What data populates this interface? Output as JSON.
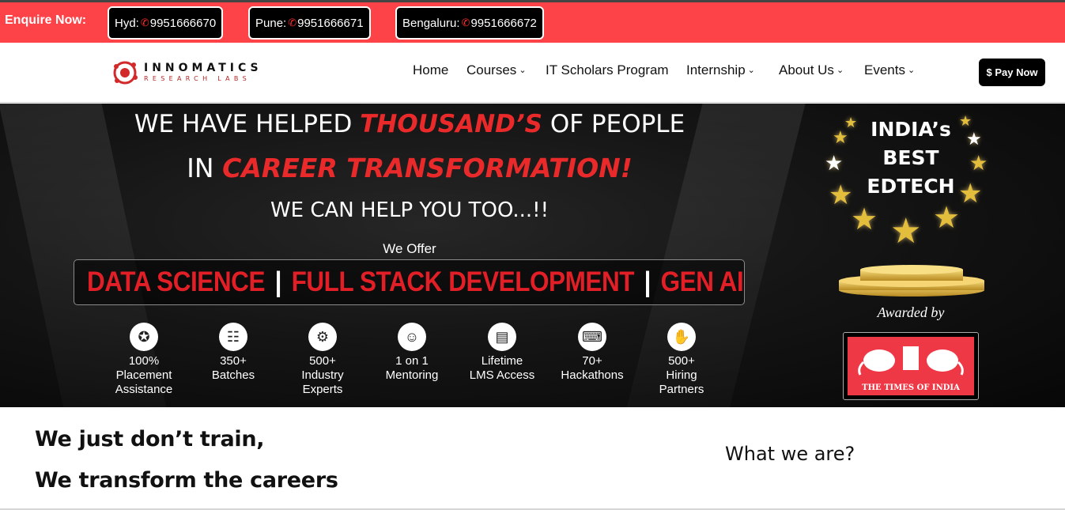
{
  "topbar": {
    "enquire_label": "Enquire Now:",
    "phones": [
      {
        "city": "Hyd:",
        "number": "9951666670"
      },
      {
        "city": "Pune:",
        "number": "9951666671"
      },
      {
        "city": "Bengaluru:",
        "number": "9951666672"
      }
    ],
    "phone_icon": "phone-icon"
  },
  "brand": {
    "name": "INNOMATICS",
    "sub": "RESEARCH LABS"
  },
  "nav": {
    "items": [
      {
        "label": "Home",
        "dropdown": false
      },
      {
        "label": "Courses",
        "dropdown": true
      },
      {
        "label": "IT Scholars Program",
        "dropdown": false
      },
      {
        "label": "Internship",
        "dropdown": true
      },
      {
        "label": "About Us",
        "dropdown": true
      },
      {
        "label": "Events",
        "dropdown": true
      }
    ],
    "pay_label": "$ Pay Now"
  },
  "hero": {
    "line1_a": "WE HAVE HELPED ",
    "line1_b": "THOUSAND’S",
    "line1_c": " OF PEOPLE",
    "line2_a": "IN ",
    "line2_b": "CAREER TRANSFORMATION!",
    "line3": "WE CAN HELP YOU TOO...!!",
    "we_offer": "We Offer",
    "offers": [
      "DATA SCIENCE",
      "FULL STACK DEVELOPMENT",
      "GEN AI"
    ],
    "offer_separator": "|",
    "stats": [
      {
        "icon": "placement-icon",
        "l1": "100%",
        "l2": "Placement",
        "l3": "Assistance"
      },
      {
        "icon": "batches-icon",
        "l1": "350+",
        "l2": "Batches",
        "l3": ""
      },
      {
        "icon": "experts-icon",
        "l1": "500+",
        "l2": "Industry",
        "l3": "Experts"
      },
      {
        "icon": "mentoring-icon",
        "l1": "1 on 1",
        "l2": "Mentoring",
        "l3": ""
      },
      {
        "icon": "lms-icon",
        "l1": "Lifetime",
        "l2": "LMS Access",
        "l3": ""
      },
      {
        "icon": "hackathon-icon",
        "l1": "70+",
        "l2": "Hackathons",
        "l3": ""
      },
      {
        "icon": "handshake-icon",
        "l1": "500+",
        "l2": "Hiring",
        "l3": "Partners"
      }
    ],
    "award": {
      "line1": "INDIA’s",
      "line2": "BEST",
      "line3": "EDTECH",
      "awarded_by": "Awarded by",
      "publisher": "THE TIMES OF INDIA"
    }
  },
  "lower": {
    "heading1": "We just don’t train,",
    "heading2": "We transform the careers",
    "what_we_are": "What we are?"
  },
  "colors": {
    "topbar": "#fd4248",
    "accent_red": "#ea2a2a",
    "offer_red": "#e21f26",
    "gold": "#e3bd3c"
  }
}
